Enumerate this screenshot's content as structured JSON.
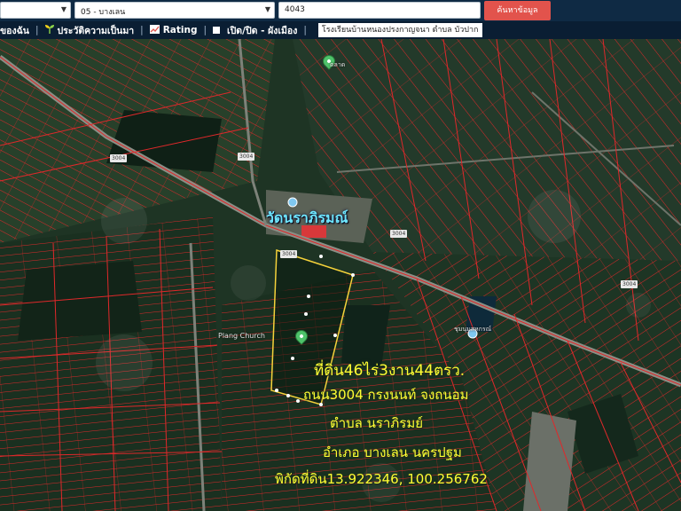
{
  "search": {
    "province_value": "",
    "district_value": "05 - บางเลน",
    "parcel_value": "4043",
    "submit_label": "ค้นหาข้อมูล"
  },
  "toolbar": {
    "my_land_label": "ของฉัน",
    "history_label": "ประวัติความเป็นมา",
    "rating_label": "Rating",
    "toggle_label": "เปิด/ปิด - ผังเมือง",
    "school_text": "โรงเรียนบ้านหนองปรงกาญจนา ตำบล บัวปาก"
  },
  "map": {
    "temple_label": "วัดนราภิรมณ์",
    "church_label": "Plang Church",
    "poi_market": "ตลาด",
    "poi_coop": "ชุมนุมสหกรณ์",
    "road_badges": [
      "3004",
      "3004",
      "3004",
      "3004",
      "3004"
    ],
    "overlay_lines": [
      "ที่ดิน46ไร่3งาน44ตรว.",
      "ถนน3004 กรงนนท์ จงถนอม",
      "ตำบล นราภิรมย์",
      "อำเภอ บางเลน นครปฐม",
      "พิกัดที่ดิน13.922346, 100.256762"
    ]
  },
  "colors": {
    "parcel_lines": "#e0282a",
    "overlay_text": "#ffff33",
    "temple_label": "#6fe7ff",
    "search_button": "#e2534c",
    "topbar": "#0f2a44",
    "plot_outline": "#f5d23a"
  }
}
